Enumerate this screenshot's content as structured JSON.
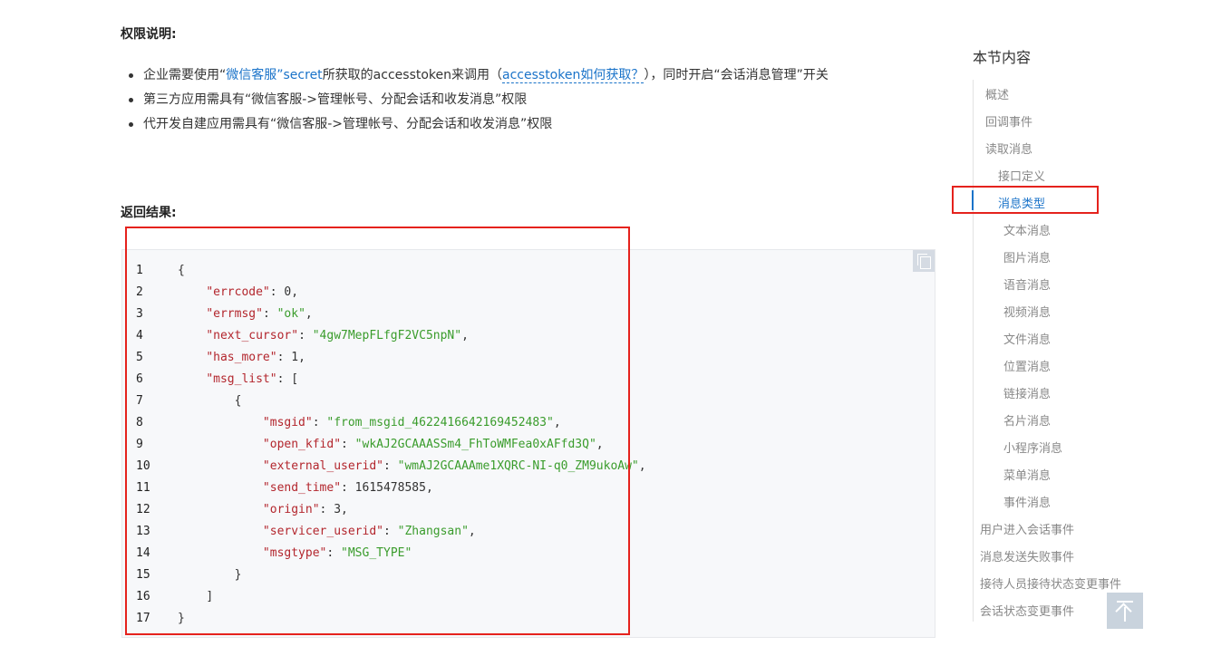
{
  "permissions": {
    "title": "权限说明:",
    "items": [
      {
        "prefix": "企业需要使用“",
        "link1": "微信客服”secret",
        "mid": "所获取的accesstoken来调用（",
        "link2": "accesstoken如何获取？",
        "suffix": "），同时开启“会话消息管理”开关"
      },
      {
        "text": "第三方应用需具有“微信客服->管理帐号、分配会话和收发消息”权限"
      },
      {
        "text": "代开发自建应用需具有“微信客服->管理帐号、分配会话和收发消息”权限"
      }
    ]
  },
  "result": {
    "title": "返回结果:",
    "code_lines": [
      {
        "num": "1",
        "indent": "",
        "parts": [
          [
            "c",
            "{"
          ]
        ]
      },
      {
        "num": "2",
        "indent": "    ",
        "parts": [
          [
            "k",
            "\"errcode\""
          ],
          [
            "c",
            ": "
          ],
          [
            "n",
            "0"
          ],
          [
            "c",
            ","
          ]
        ]
      },
      {
        "num": "3",
        "indent": "    ",
        "parts": [
          [
            "k",
            "\"errmsg\""
          ],
          [
            "c",
            ": "
          ],
          [
            "s",
            "\"ok\""
          ],
          [
            "c",
            ","
          ]
        ]
      },
      {
        "num": "4",
        "indent": "    ",
        "parts": [
          [
            "k",
            "\"next_cursor\""
          ],
          [
            "c",
            ": "
          ],
          [
            "s",
            "\"4gw7MepFLfgF2VC5npN\""
          ],
          [
            "c",
            ","
          ]
        ]
      },
      {
        "num": "5",
        "indent": "    ",
        "parts": [
          [
            "k",
            "\"has_more\""
          ],
          [
            "c",
            ": "
          ],
          [
            "n",
            "1"
          ],
          [
            "c",
            ","
          ]
        ]
      },
      {
        "num": "6",
        "indent": "    ",
        "parts": [
          [
            "k",
            "\"msg_list\""
          ],
          [
            "c",
            ": ["
          ]
        ]
      },
      {
        "num": "7",
        "indent": "        ",
        "parts": [
          [
            "c",
            "{"
          ]
        ]
      },
      {
        "num": "8",
        "indent": "            ",
        "parts": [
          [
            "k",
            "\"msgid\""
          ],
          [
            "c",
            ": "
          ],
          [
            "s",
            "\"from_msgid_4622416642169452483\""
          ],
          [
            "c",
            ","
          ]
        ]
      },
      {
        "num": "9",
        "indent": "            ",
        "parts": [
          [
            "k",
            "\"open_kfid\""
          ],
          [
            "c",
            ": "
          ],
          [
            "s",
            "\"wkAJ2GCAAASSm4_FhToWMFea0xAFfd3Q\""
          ],
          [
            "c",
            ","
          ]
        ]
      },
      {
        "num": "10",
        "indent": "            ",
        "parts": [
          [
            "k",
            "\"external_userid\""
          ],
          [
            "c",
            ": "
          ],
          [
            "s",
            "\"wmAJ2GCAAAme1XQRC-NI-q0_ZM9ukoAw\""
          ],
          [
            "c",
            ","
          ]
        ]
      },
      {
        "num": "11",
        "indent": "            ",
        "parts": [
          [
            "k",
            "\"send_time\""
          ],
          [
            "c",
            ": "
          ],
          [
            "n",
            "1615478585"
          ],
          [
            "c",
            ","
          ]
        ]
      },
      {
        "num": "12",
        "indent": "            ",
        "parts": [
          [
            "k",
            "\"origin\""
          ],
          [
            "c",
            ": "
          ],
          [
            "n",
            "3"
          ],
          [
            "c",
            ","
          ]
        ]
      },
      {
        "num": "13",
        "indent": "            ",
        "parts": [
          [
            "k",
            "\"servicer_userid\""
          ],
          [
            "c",
            ": "
          ],
          [
            "s",
            "\"Zhangsan\""
          ],
          [
            "c",
            ","
          ]
        ]
      },
      {
        "num": "14",
        "indent": "            ",
        "parts": [
          [
            "k",
            "\"msgtype\""
          ],
          [
            "c",
            ": "
          ],
          [
            "s",
            "\"MSG_TYPE\""
          ]
        ]
      },
      {
        "num": "15",
        "indent": "        ",
        "parts": [
          [
            "c",
            "}"
          ]
        ]
      },
      {
        "num": "16",
        "indent": "    ",
        "parts": [
          [
            "c",
            "]"
          ]
        ]
      },
      {
        "num": "17",
        "indent": "",
        "parts": [
          [
            "c",
            "}"
          ]
        ]
      }
    ]
  },
  "toc": {
    "title": "本节内容",
    "items": [
      {
        "label": "概述"
      },
      {
        "label": "回调事件"
      },
      {
        "label": "读取消息"
      },
      {
        "label": "接口定义"
      },
      {
        "label": "消息类型",
        "active": true
      },
      {
        "label": "文本消息"
      },
      {
        "label": "图片消息"
      },
      {
        "label": "语音消息"
      },
      {
        "label": "视频消息"
      },
      {
        "label": "文件消息"
      },
      {
        "label": "位置消息"
      },
      {
        "label": "链接消息"
      },
      {
        "label": "名片消息"
      },
      {
        "label": "小程序消息"
      },
      {
        "label": "菜单消息"
      },
      {
        "label": "事件消息"
      },
      {
        "label": "用户进入会话事件"
      },
      {
        "label": "消息发送失败事件"
      },
      {
        "label": "接待人员接待状态变更事件"
      },
      {
        "label": "会话状态变更事件"
      }
    ]
  },
  "colors": {
    "link": "#1a73c9",
    "key": "#b3262d",
    "string": "#3a9c2c",
    "highlight": "#e5221d"
  },
  "icons": {
    "copy": "copy-icon",
    "back_to_top": "arrow-up-to-top-icon"
  }
}
